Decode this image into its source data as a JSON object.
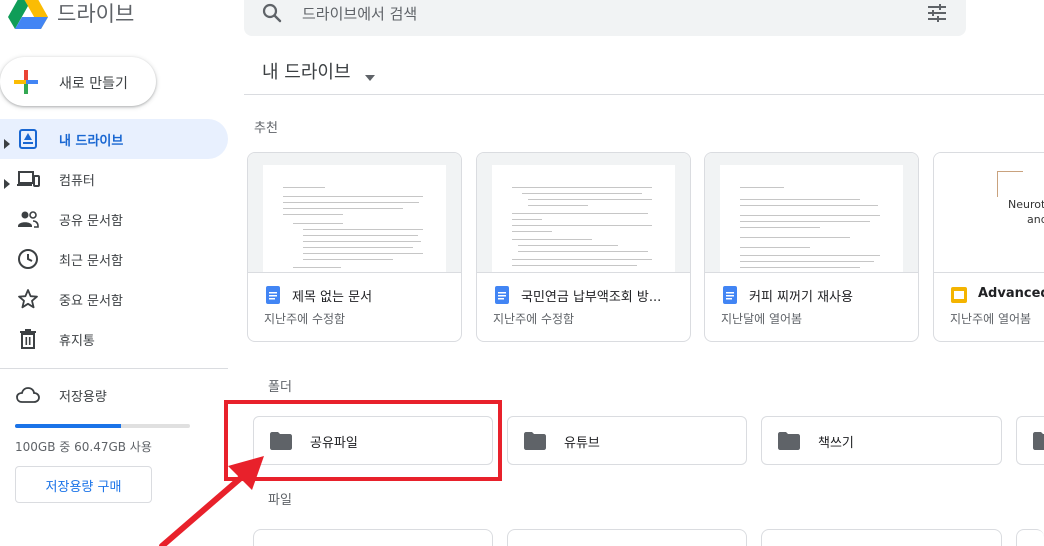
{
  "header": {
    "app_title": "드라이브",
    "search_placeholder": "드라이브에서 검색",
    "logo_icon": "google-drive-logo",
    "search_icon": "search-icon",
    "filter_icon": "tune-icon"
  },
  "sidebar": {
    "new_button_label": "새로 만들기",
    "items": [
      {
        "label": "내 드라이브",
        "icon": "my-drive-icon",
        "active": true,
        "expandable": true
      },
      {
        "label": "컴퓨터",
        "icon": "computer-icon",
        "active": false,
        "expandable": true
      },
      {
        "label": "공유 문서함",
        "icon": "shared-icon",
        "active": false,
        "expandable": false
      },
      {
        "label": "최근 문서함",
        "icon": "clock-icon",
        "active": false,
        "expandable": false
      },
      {
        "label": "중요 문서함",
        "icon": "star-icon",
        "active": false,
        "expandable": false
      },
      {
        "label": "휴지통",
        "icon": "trash-icon",
        "active": false,
        "expandable": false
      }
    ],
    "storage": {
      "label": "저장용량",
      "icon": "cloud-icon",
      "usage_text": "100GB 중 60.47GB 사용",
      "used_fraction": 0.6047,
      "buy_label": "저장용량 구매"
    }
  },
  "main": {
    "title": "내 드라이브",
    "suggested_label": "추천",
    "suggested": [
      {
        "name": "제목 없는 문서",
        "sub": "지난주에 수정함",
        "type": "docs"
      },
      {
        "name": "국민연금 납부액조회 방...",
        "sub": "지난주에 수정함",
        "type": "docs"
      },
      {
        "name": "커피 찌꺼기 재사용",
        "sub": "지난달에 열어봄",
        "type": "docs"
      },
      {
        "name": "Advanced M",
        "sub": "지난주에 열어봄",
        "type": "slides",
        "thumb_text": [
          "Neurotran",
          "and Di"
        ]
      }
    ],
    "folders_label": "폴더",
    "folders": [
      {
        "name": "공유파일"
      },
      {
        "name": "유튜브"
      },
      {
        "name": "책쓰기"
      },
      {
        "name": ""
      }
    ],
    "files_label": "파일"
  },
  "colors": {
    "accent": "#1a73e8",
    "active_bg": "#e8f0fe",
    "annotation_red": "#e8212b"
  }
}
